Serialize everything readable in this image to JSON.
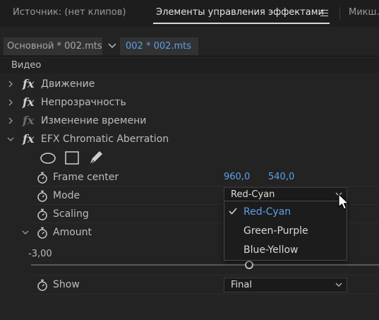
{
  "tabs": [
    {
      "label": "Источник: (нет клипов)"
    },
    {
      "label": "Элементы управления эффектами"
    },
    {
      "label": "Микш."
    }
  ],
  "clips": {
    "master": "Основной * 002.mts",
    "sequence": "002 * 002.mts"
  },
  "section": {
    "label": "Видео"
  },
  "effects": [
    {
      "label": "Движение"
    },
    {
      "label": "Непрозрачность"
    },
    {
      "label": "Изменение времени"
    },
    {
      "label": "EFX Chromatic Aberration"
    }
  ],
  "params": {
    "frame_center": {
      "label": "Frame center",
      "x": "960,0",
      "y": "540,0"
    },
    "mode": {
      "label": "Mode",
      "value": "Red-Cyan"
    },
    "scaling": {
      "label": "Scaling"
    },
    "amount": {
      "label": "Amount",
      "value": "-3,00"
    },
    "show": {
      "label": "Show",
      "value": "Final"
    }
  },
  "mode_options": [
    {
      "label": "Red-Cyan",
      "selected": true
    },
    {
      "label": "Green-Purple",
      "selected": false
    },
    {
      "label": "Blue-Yellow",
      "selected": false
    }
  ],
  "icons": {
    "fx": "fx",
    "menu": "hamburger-menu-icon",
    "stopwatch": "stopwatch-icon",
    "ellipse_mask": "ellipse-mask-icon",
    "rect_mask": "rectangle-mask-icon",
    "pen_mask": "pen-mask-icon"
  },
  "colors": {
    "accent": "#5ca0ea",
    "background": "#232323",
    "text": "#bcbcbc"
  }
}
